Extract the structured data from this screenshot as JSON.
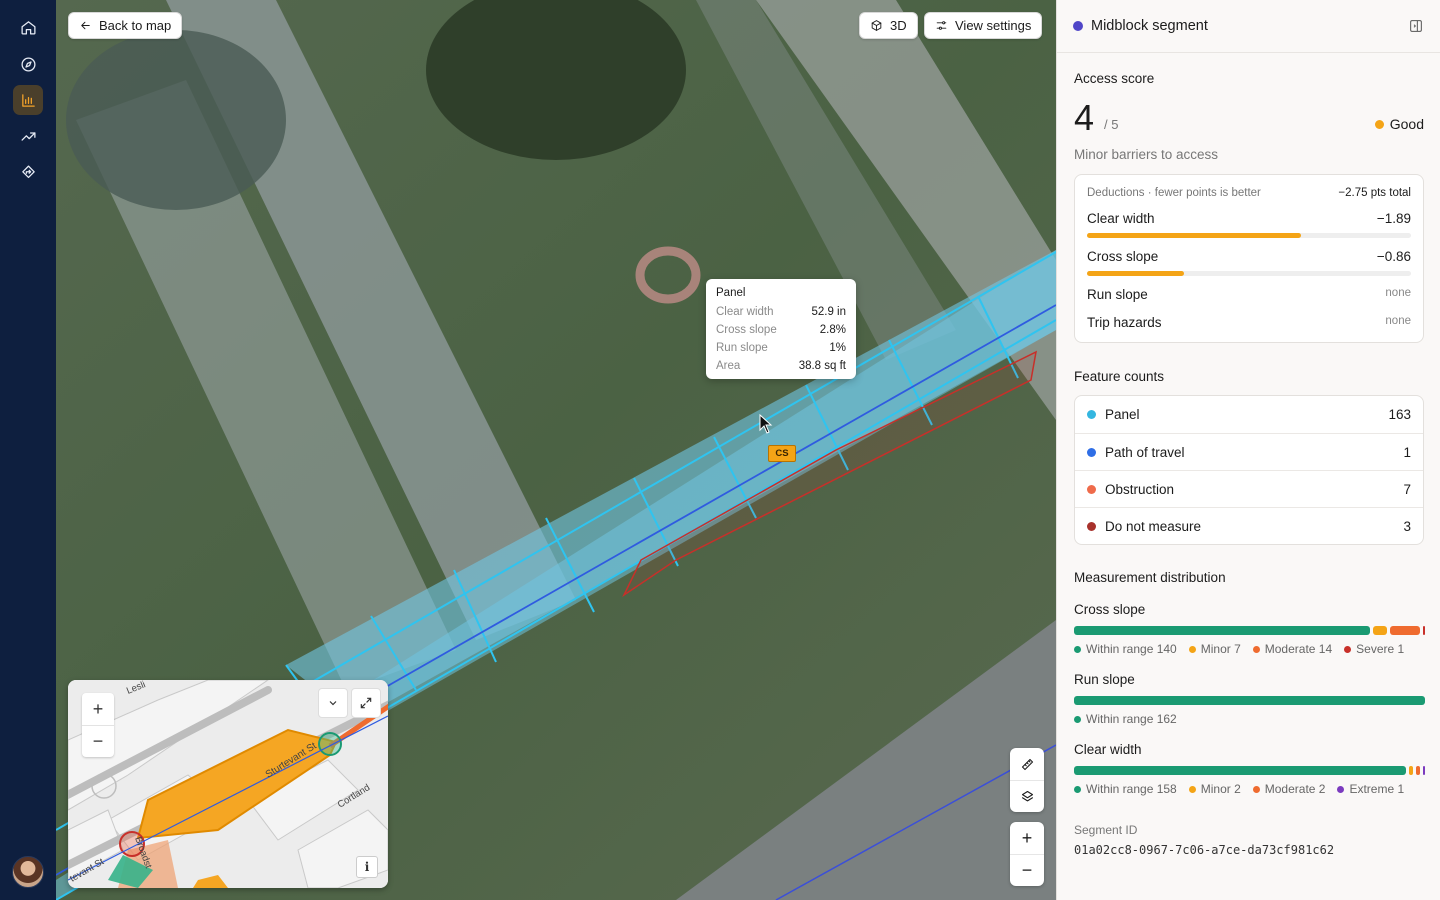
{
  "rail": {
    "items": [
      {
        "icon": "home-icon"
      },
      {
        "icon": "compass-icon"
      },
      {
        "icon": "bar-chart-icon",
        "active": true
      },
      {
        "icon": "trending-up-icon"
      },
      {
        "icon": "route-icon"
      }
    ]
  },
  "toolbar": {
    "back_label": "Back to map",
    "threed_label": "3D",
    "view_settings_label": "View settings"
  },
  "tooltip": {
    "title": "Panel",
    "rows": [
      {
        "label": "Clear width",
        "value": "52.9 in"
      },
      {
        "label": "Cross slope",
        "value": "2.8%"
      },
      {
        "label": "Run slope",
        "value": "1%"
      },
      {
        "label": "Area",
        "value": "38.8 sq ft"
      }
    ]
  },
  "map_tag": "CS",
  "map_controls": {
    "zoom_in": "+",
    "zoom_out": "−"
  },
  "minimap": {
    "zoom_in": "+",
    "zoom_out": "−",
    "info": "i",
    "street_labels": [
      "Lesli",
      "Sturtevant St",
      "Cortland",
      "Broadst",
      "tevant St"
    ]
  },
  "panel": {
    "title": "Midblock segment",
    "title_dot_color": "#5046c8",
    "access_label": "Access score",
    "score": "4",
    "score_of": "/ 5",
    "rating": "Good",
    "rating_color": "#f4a416",
    "summary": "Minor barriers to access",
    "deductions": {
      "header": "Deductions · fewer points is better",
      "total": "−2.75 pts total",
      "rows": [
        {
          "label": "Clear width",
          "value": "−1.89",
          "fill": 0.66
        },
        {
          "label": "Cross slope",
          "value": "−0.86",
          "fill": 0.3
        },
        {
          "label": "Run slope",
          "value": "none"
        },
        {
          "label": "Trip hazards",
          "value": "none"
        }
      ]
    },
    "features_label": "Feature counts",
    "features": [
      {
        "label": "Panel",
        "count": "163",
        "color": "#34b6e0"
      },
      {
        "label": "Path of travel",
        "count": "1",
        "color": "#2f6ee6"
      },
      {
        "label": "Obstruction",
        "count": "7",
        "color": "#ef6b4b"
      },
      {
        "label": "Do not measure",
        "count": "3",
        "color": "#a8322c"
      }
    ],
    "distribution_label": "Measurement distribution",
    "distributions": [
      {
        "label": "Cross slope",
        "segments": [
          {
            "label": "Within range 140",
            "count": 140,
            "color": "#1a9a72"
          },
          {
            "label": "Minor 7",
            "count": 7,
            "color": "#f4a416"
          },
          {
            "label": "Moderate 14",
            "count": 14,
            "color": "#ef6b2f"
          },
          {
            "label": "Severe 1",
            "count": 1,
            "color": "#c8302a"
          }
        ]
      },
      {
        "label": "Run slope",
        "segments": [
          {
            "label": "Within range 162",
            "count": 162,
            "color": "#1a9a72"
          }
        ]
      },
      {
        "label": "Clear width",
        "segments": [
          {
            "label": "Within range 158",
            "count": 158,
            "color": "#1a9a72"
          },
          {
            "label": "Minor 2",
            "count": 2,
            "color": "#f4a416"
          },
          {
            "label": "Moderate 2",
            "count": 2,
            "color": "#ef6b2f"
          },
          {
            "label": "Extreme 1",
            "count": 1,
            "color": "#7b3bbf"
          }
        ]
      }
    ],
    "segment_id_label": "Segment ID",
    "segment_id": "01a02cc8-0967-7c06-a7ce-da73cf981c62"
  }
}
